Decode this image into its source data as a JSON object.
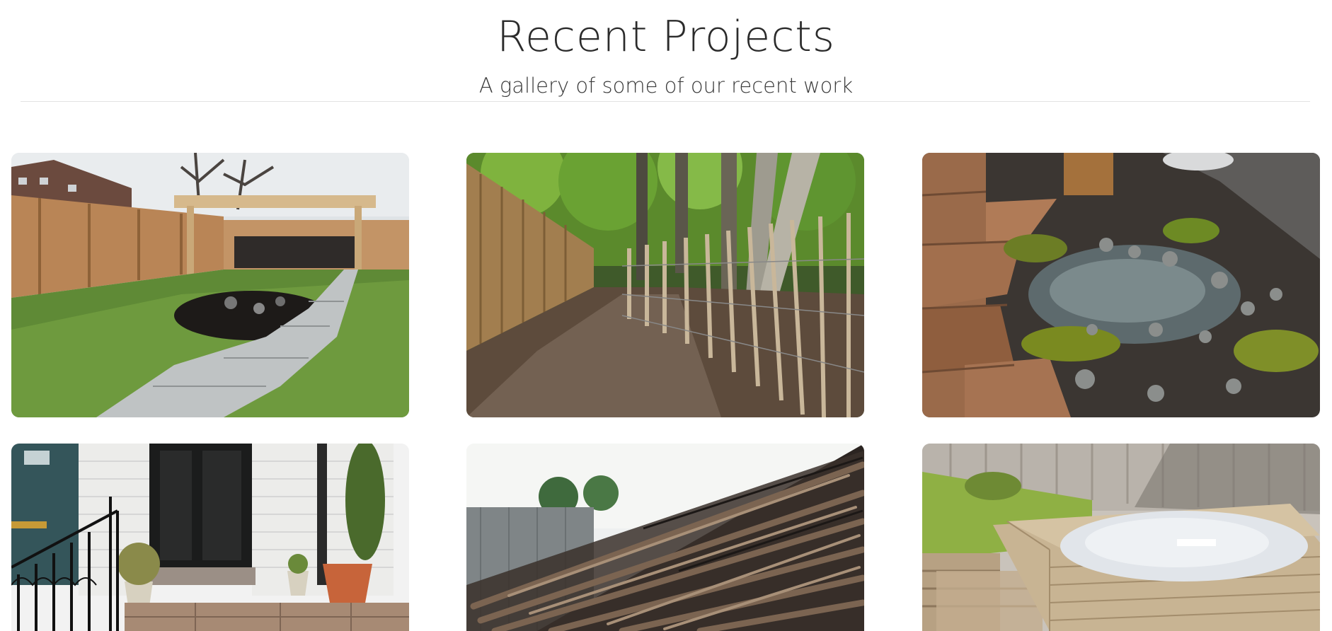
{
  "header": {
    "title": "Recent Projects",
    "subtitle": "A gallery of some of our recent work"
  },
  "gallery": {
    "items": [
      {
        "name": "garden-path-lawn-photo"
      },
      {
        "name": "woodland-fence-path-photo"
      },
      {
        "name": "rock-garden-water-feature-photo"
      },
      {
        "name": "front-doorstep-patio-photo"
      },
      {
        "name": "woven-willow-fence-photo"
      },
      {
        "name": "decking-hot-tub-photo"
      }
    ]
  },
  "colors": {
    "text": "#2b2b2b",
    "divider": "#e2e2e2",
    "background": "#ffffff"
  }
}
